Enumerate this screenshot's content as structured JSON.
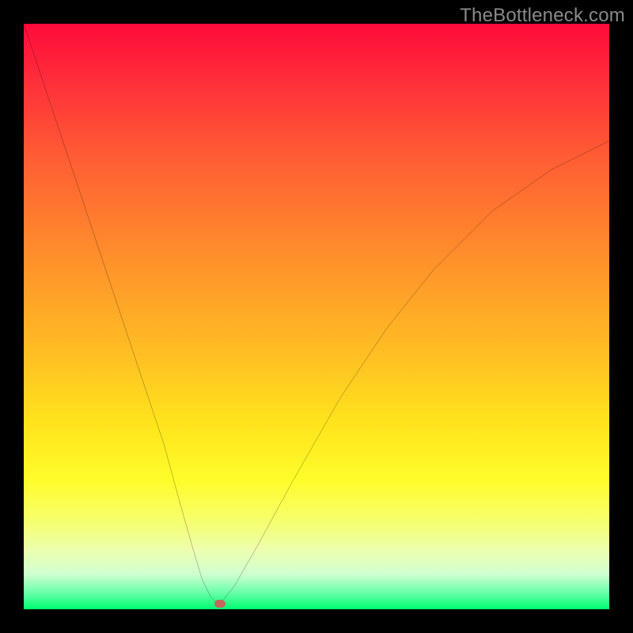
{
  "watermark": "TheBottleneck.com",
  "chart_data": {
    "type": "line",
    "title": "",
    "xlabel": "",
    "ylabel": "",
    "xlim": [
      0,
      100
    ],
    "ylim": [
      0,
      100
    ],
    "gradient_stops": [
      {
        "pos": 0,
        "color": "#ff0a3a"
      },
      {
        "pos": 50,
        "color": "#ffc322"
      },
      {
        "pos": 78,
        "color": "#fffc2a"
      },
      {
        "pos": 100,
        "color": "#00ff70"
      }
    ],
    "series": [
      {
        "name": "bottleneck-curve",
        "x": [
          0,
          4,
          8,
          12,
          16,
          20,
          24,
          27,
          29,
          30.5,
          32,
          33,
          34,
          36,
          40,
          46,
          54,
          62,
          70,
          80,
          90,
          100
        ],
        "y": [
          100,
          88,
          76,
          64,
          52,
          40,
          28,
          17,
          10,
          5,
          2,
          1,
          1.5,
          4,
          11,
          22,
          36,
          48,
          58,
          68,
          75,
          80
        ]
      }
    ],
    "marker": {
      "x": 33.5,
      "y": 1
    },
    "legend": [],
    "annotations": []
  }
}
